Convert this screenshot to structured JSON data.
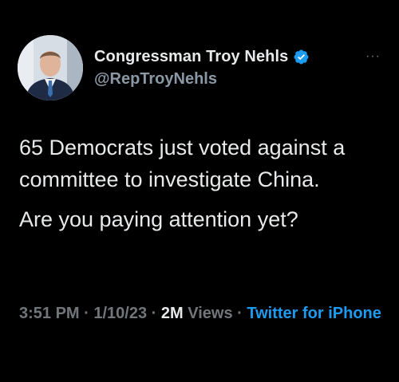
{
  "tweet": {
    "author": {
      "display_name": "Congressman Troy Nehls",
      "handle": "@RepTroyNehls",
      "verified_icon": "verified-badge-icon",
      "avatar": "profile-photo"
    },
    "more_icon": "more-options-icon",
    "more_glyph": "···",
    "text_lines": [
      "65 Democrats just voted against a committee to investigate China.",
      "Are you paying attention yet?"
    ],
    "meta": {
      "time": "3:51 PM",
      "sep1": " · ",
      "date": "1/10/23",
      "sep2": " · ",
      "views_count": "2M",
      "views_label": " Views",
      "sep3": " · ",
      "source": "Twitter for iPhone"
    }
  },
  "colors": {
    "background": "#000000",
    "text_primary": "#e7e9ea",
    "text_secondary": "#71767b",
    "accent": "#1d9bf0"
  }
}
